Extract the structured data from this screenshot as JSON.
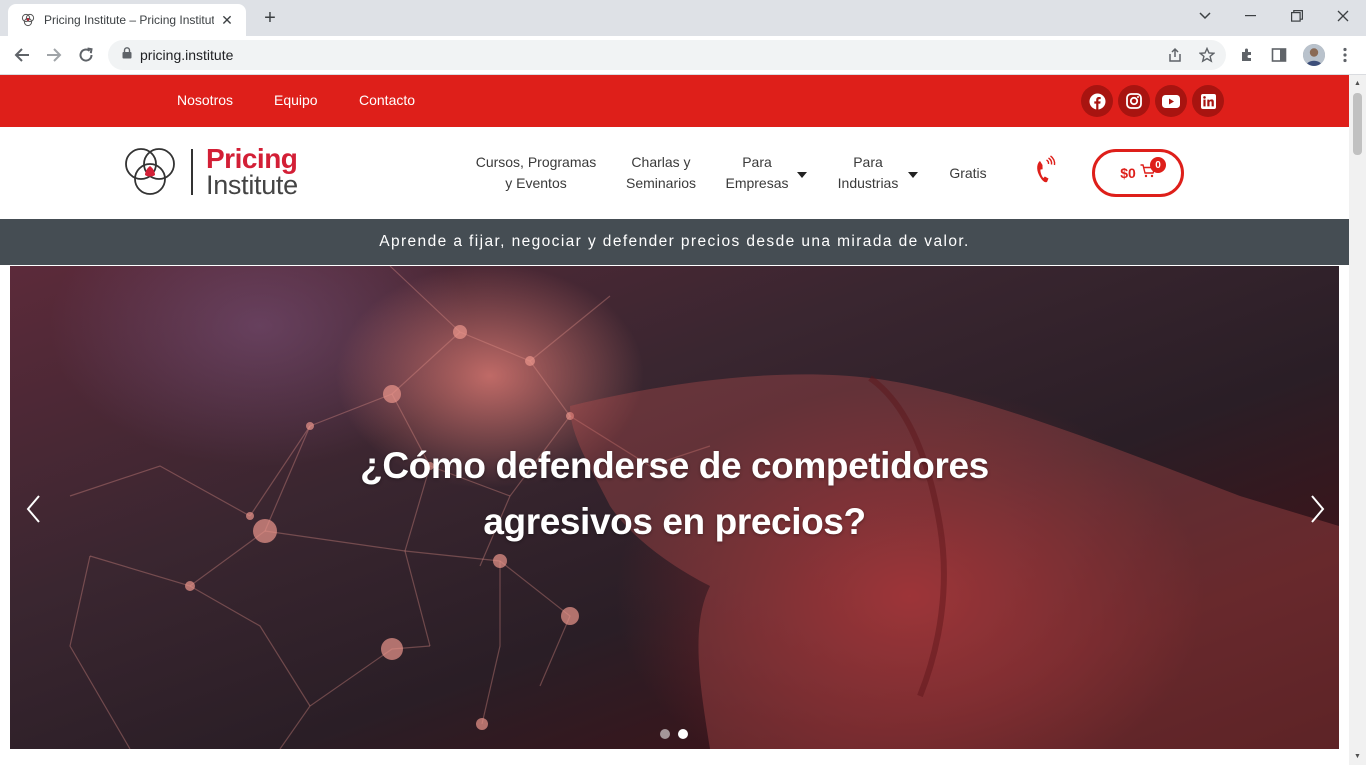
{
  "browser": {
    "tab_title": "Pricing Institute – Pricing Institute",
    "url": "pricing.institute"
  },
  "topbar": {
    "nav": [
      "Nosotros",
      "Equipo",
      "Contacto"
    ],
    "social_icons": [
      "facebook-icon",
      "instagram-icon",
      "youtube-icon",
      "linkedin-icon"
    ],
    "color": "#de1f1a"
  },
  "logo": {
    "word1": "Pricing",
    "word2": "Institute"
  },
  "menu": {
    "cursos_l1": "Cursos, Programas",
    "cursos_l2": "y Eventos",
    "charlas_l1": "Charlas y",
    "charlas_l2": "Seminarios",
    "empresas_l1": "Para",
    "empresas_l2": "Empresas",
    "industrias_l1": "Para",
    "industrias_l2": "Industrias",
    "gratis": "Gratis"
  },
  "cart": {
    "amount": "$0",
    "count": "0"
  },
  "tagline": "Aprende a fijar, negociar y defender precios desde una mirada de valor.",
  "hero": {
    "title_line1": "¿Cómo defenderse de competidores",
    "title_line2": "agresivos en precios?",
    "slides_total": 2,
    "active_slide": 2
  }
}
